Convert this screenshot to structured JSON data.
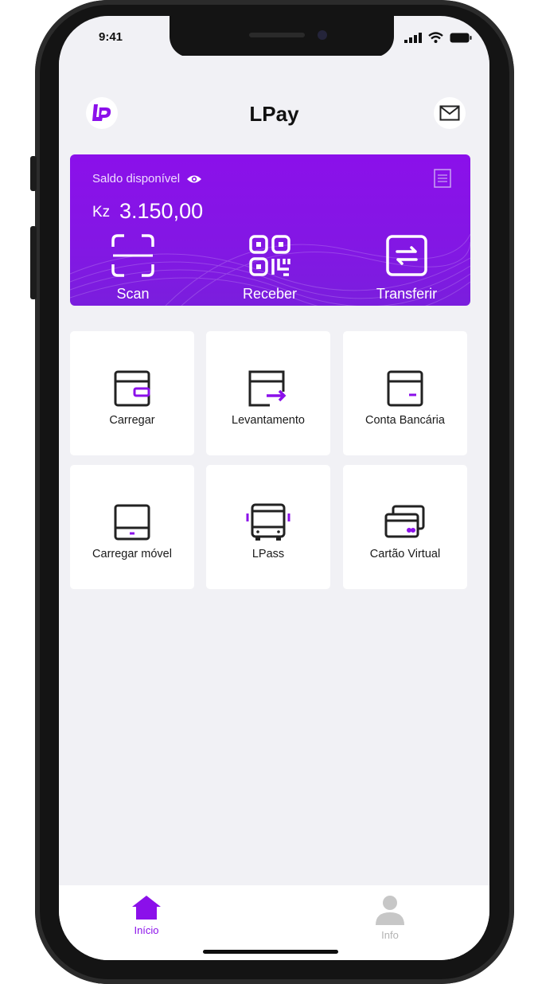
{
  "status": {
    "time": "9:41"
  },
  "header": {
    "title": "LPay",
    "logo_icon": "lpay-logo-icon",
    "mail_icon": "mail-icon"
  },
  "balance": {
    "label": "Saldo disponível",
    "currency": "Kz",
    "amount": "3.150,00",
    "actions": [
      {
        "label": "Scan",
        "icon": "scan-icon"
      },
      {
        "label": "Receber",
        "icon": "qr-code-icon"
      },
      {
        "label": "Transferir",
        "icon": "transfer-icon"
      }
    ]
  },
  "services": [
    {
      "label": "Carregar",
      "icon": "wallet-icon"
    },
    {
      "label": "Levantamento",
      "icon": "withdraw-icon"
    },
    {
      "label": "Conta Bancária",
      "icon": "bank-account-icon"
    },
    {
      "label": "Carregar móvel",
      "icon": "mobile-topup-icon"
    },
    {
      "label": "LPass",
      "icon": "bus-icon"
    },
    {
      "label": "Cartão Virtual",
      "icon": "virtual-card-icon"
    }
  ],
  "tabs": [
    {
      "label": "Início",
      "icon": "home-icon",
      "active": true
    },
    {
      "label": "Info",
      "icon": "user-icon",
      "active": false
    }
  ],
  "colors": {
    "accent": "#8b10ea",
    "background": "#f1f1f5",
    "inactive": "#b3b3b3"
  }
}
